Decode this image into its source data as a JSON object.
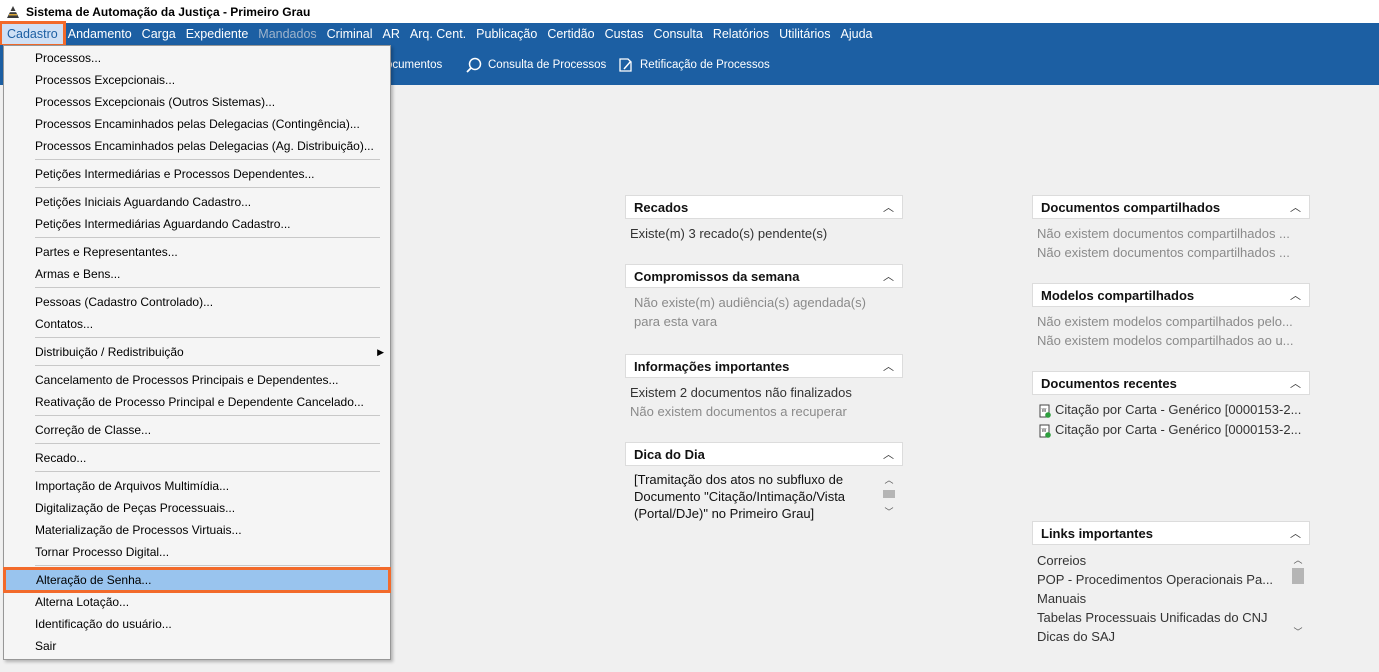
{
  "window": {
    "title": "Sistema de Automação da Justiça - Primeiro Grau"
  },
  "menubar": {
    "items": [
      {
        "label": "Cadastro",
        "state": "active"
      },
      {
        "label": "Andamento"
      },
      {
        "label": "Carga"
      },
      {
        "label": "Expediente"
      },
      {
        "label": "Mandados",
        "state": "disabled"
      },
      {
        "label": "Criminal"
      },
      {
        "label": "AR"
      },
      {
        "label": "Arq. Cent."
      },
      {
        "label": "Publicação"
      },
      {
        "label": "Certidão"
      },
      {
        "label": "Custas"
      },
      {
        "label": "Consulta"
      },
      {
        "label": "Relatórios"
      },
      {
        "label": "Utilitários"
      },
      {
        "label": "Ajuda"
      }
    ]
  },
  "toolbar": {
    "partial_label": "ocumentos",
    "consulta_label": "Consulta de Processos",
    "retificacao_label": "Retificação de Processos"
  },
  "dropdown": {
    "items": [
      {
        "label": "Processos..."
      },
      {
        "label": "Processos Excepcionais..."
      },
      {
        "label": "Processos Excepcionais (Outros Sistemas)..."
      },
      {
        "label": "Processos Encaminhados pelas Delegacias (Contingência)..."
      },
      {
        "label": "Processos Encaminhados pelas Delegacias (Ag. Distribuição)..."
      },
      {
        "sep": true
      },
      {
        "label": "Petições Intermediárias e Processos Dependentes..."
      },
      {
        "sep": true
      },
      {
        "label": "Petições Iniciais Aguardando Cadastro..."
      },
      {
        "label": "Petições Intermediárias Aguardando Cadastro..."
      },
      {
        "sep": true
      },
      {
        "label": "Partes e Representantes..."
      },
      {
        "label": "Armas e Bens..."
      },
      {
        "sep": true
      },
      {
        "label": "Pessoas (Cadastro Controlado)..."
      },
      {
        "label": "Contatos..."
      },
      {
        "sep": true
      },
      {
        "label": "Distribuição / Redistribuição",
        "submenu": true
      },
      {
        "sep": true
      },
      {
        "label": "Cancelamento de Processos Principais e Dependentes..."
      },
      {
        "label": "Reativação de Processo Principal e Dependente Cancelado..."
      },
      {
        "sep": true
      },
      {
        "label": "Correção de Classe..."
      },
      {
        "sep": true
      },
      {
        "label": "Recado..."
      },
      {
        "sep": true
      },
      {
        "label": "Importação de Arquivos Multimídia..."
      },
      {
        "label": "Digitalização de Peças Processuais..."
      },
      {
        "label": "Materialização de Processos Virtuais..."
      },
      {
        "label": "Tornar Processo Digital..."
      },
      {
        "sep": true
      },
      {
        "label": "Alteração de Senha...",
        "selected": true
      },
      {
        "label": "Alterna Lotação..."
      },
      {
        "label": "Identificação do usuário..."
      },
      {
        "label": "Sair"
      }
    ]
  },
  "panels": {
    "recados": {
      "title": "Recados",
      "text": "Existe(m) 3 recado(s) pendente(s)"
    },
    "compromissos": {
      "title": "Compromissos da semana",
      "line1": "Não existe(m) audiência(s) agendada(s)",
      "line2": "para esta vara"
    },
    "informacoes": {
      "title": "Informações importantes",
      "line1": "Existem 2 documentos não finalizados",
      "line2": "Não existem documentos a recuperar"
    },
    "dica": {
      "title": "Dica do Dia",
      "line1": "[Tramitação dos atos no subfluxo de",
      "line2": "Documento \"Citação/Intimação/Vista",
      "line3": "(Portal/DJe)\" no Primeiro Grau]"
    },
    "docs_compartilhados": {
      "title": "Documentos compartilhados",
      "line1": "Não existem documentos compartilhados ...",
      "line2": "Não existem documentos compartilhados ..."
    },
    "modelos": {
      "title": "Modelos compartilhados",
      "line1": "Não existem modelos compartilhados pelo...",
      "line2": "Não existem modelos compartilhados ao u..."
    },
    "recentes": {
      "title": "Documentos recentes",
      "line1": "Citação por Carta - Genérico [0000153-2...",
      "line2": "Citação por Carta - Genérico [0000153-2..."
    },
    "links": {
      "title": "Links importantes",
      "items": [
        "Correios",
        "POP - Procedimentos Operacionais Pa...",
        "Manuais",
        "Tabelas Processuais Unificadas do CNJ",
        "Dicas do SAJ"
      ]
    }
  },
  "colors": {
    "menubar": "#1c5fa3",
    "highlight": "#f26a2b",
    "selected": "#99c4ee"
  }
}
